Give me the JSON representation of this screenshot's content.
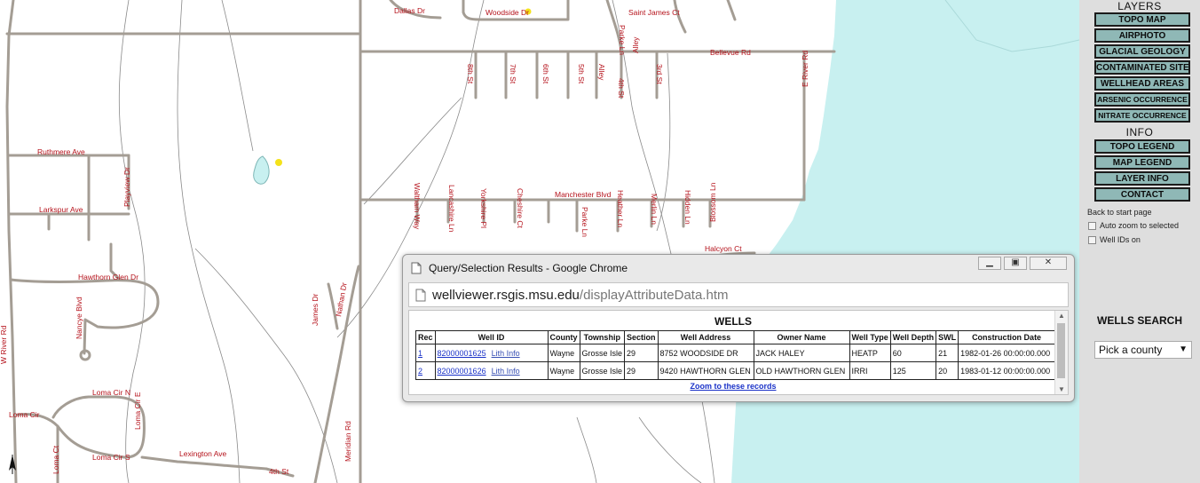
{
  "map": {
    "streets": {
      "dallas": "Dallas Dr",
      "woodside": "Woodside Dr",
      "saint_james": "Saint James Ct",
      "parke_top": "Parke Ln",
      "alley_top": "Alley",
      "bellevue": "Bellevue Rd",
      "st8": "8th St",
      "st7": "7th St",
      "st6": "6th St",
      "st5": "5th St",
      "alley_mid": "Alley",
      "st4": "4th St",
      "st3": "3rd St",
      "e_river": "E River Rd",
      "ruthmere": "Ruthmere Ave",
      "playview": "Playview Dr",
      "larkspur": "Larkspur Ave",
      "hawthorn": "Hawthorn Glen Dr",
      "w_river": "W River Rd",
      "nancye": "Nancye Blvd",
      "loma_cir_n": "Loma Cir N",
      "loma_cir": "Loma Cir",
      "loma_cir_e": "Loma Cir E",
      "loma_cir_s": "Loma Cir S",
      "loma_ct": "Loma Ct",
      "lexington": "Lexington Ave",
      "st4_bottom": "4th St",
      "meridian": "Meridian Rd",
      "james": "James Dr",
      "nathan": "Nathan Dr",
      "manchester": "Manchester Blvd",
      "waltham": "Waltham Way",
      "lancashire": "Lancashire Ln",
      "yorkshire": "Yorkshire Pl",
      "cheshire": "Cheshire Ct",
      "parke_mid": "Parke Ln",
      "heather": "Heather Ln",
      "merlin": "Merlin Ln",
      "hidden": "Hidden Ln",
      "blossom": "Blossom Ln",
      "halcyon": "Halcyon Ct"
    }
  },
  "sidebar": {
    "layers_title": "LAYERS",
    "layers": [
      "TOPO MAP",
      "AIRPHOTO",
      "GLACIAL GEOLOGY",
      "CONTAMINATED SITES",
      "WELLHEAD AREAS",
      "ARSENIC OCCURRENCE",
      "NITRATE OCCURRENCE"
    ],
    "info_title": "INFO",
    "info": [
      "TOPO LEGEND",
      "MAP LEGEND",
      "LAYER INFO",
      "CONTACT"
    ],
    "back_link": "Back to start page",
    "auto_zoom": "Auto zoom to selected",
    "well_ids": "Well IDs on",
    "wells_search": "WELLS SEARCH",
    "county_select": "Pick a county"
  },
  "popup": {
    "title": "Query/Selection Results - Google Chrome",
    "url_host": "wellviewer.rsgis.msu.edu",
    "url_path": "/displayAttributeData.htm",
    "wells_title": "WELLS",
    "headers": [
      "Rec",
      "Well ID",
      "County",
      "Township",
      "Section",
      "Well Address",
      "Owner Name",
      "Well Type",
      "Well Depth",
      "SWL",
      "Construction Date"
    ],
    "rows": [
      {
        "rec": "1",
        "well_id": "82000001625",
        "lith": "Lith Info",
        "county": "Wayne",
        "township": "Grosse Isle",
        "section": "29",
        "address": "8752 WOODSIDE DR",
        "owner": "JACK HALEY",
        "type": "HEATP",
        "depth": "60",
        "swl": "21",
        "date": "1982-01-26 00:00:00.000"
      },
      {
        "rec": "2",
        "well_id": "82000001626",
        "lith": "Lith Info",
        "county": "Wayne",
        "township": "Grosse Isle",
        "section": "29",
        "address": "9420 HAWTHORN GLEN",
        "owner": "OLD HAWTHORN GLEN",
        "type": "IRRI",
        "depth": "125",
        "swl": "20",
        "date": "1983-01-12 00:00:00.000"
      }
    ],
    "zoom_link": "Zoom to these records"
  },
  "colors": {
    "road": "#a49d94",
    "water": "#c8f0f0",
    "street_label": "#b5121b",
    "button_bg": "#8fb8b6",
    "sidebar_bg": "#dedede"
  }
}
